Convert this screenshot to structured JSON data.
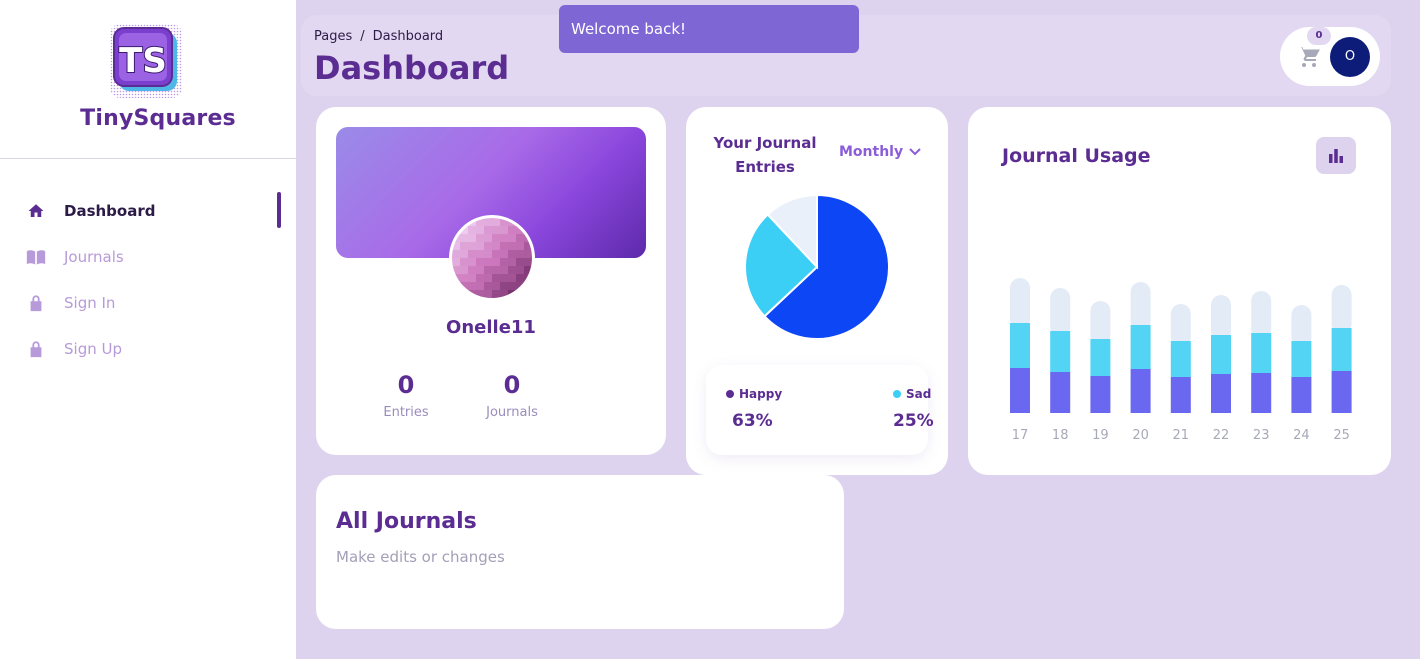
{
  "brand": {
    "name": "TinySquares",
    "logo_text": "TS"
  },
  "sidebar": {
    "items": [
      {
        "label": "Dashboard",
        "icon": "home-icon",
        "active": true
      },
      {
        "label": "Journals",
        "icon": "book-icon",
        "active": false
      },
      {
        "label": "Sign In",
        "icon": "lock-icon",
        "active": false
      },
      {
        "label": "Sign Up",
        "icon": "lock-icon",
        "active": false
      }
    ]
  },
  "header": {
    "breadcrumb": [
      "Pages",
      "Dashboard"
    ],
    "breadcrumb_sep": "/",
    "title": "Dashboard",
    "cart_count": "0",
    "avatar_initial": "O"
  },
  "toast": {
    "message": "Welcome back!"
  },
  "profile": {
    "username": "Onelle11",
    "entries_value": "0",
    "entries_label": "Entries",
    "journals_value": "0",
    "journals_label": "Journals"
  },
  "pie_card": {
    "title": "Your Journal Entries",
    "period": "Monthly"
  },
  "usage_card": {
    "title": "Journal Usage"
  },
  "journals_section": {
    "title": "All Journals",
    "subtitle": "Make edits or changes"
  },
  "colors": {
    "accent": "#5b2c91",
    "happy": "#0d47f5",
    "sad": "#3ccff5",
    "other": "#eaf0fa",
    "bar_base": "#6a67f0",
    "bar_mid": "#53d4f5",
    "bar_top": "#e3ebf6"
  },
  "chart_data": [
    {
      "type": "pie",
      "title": "Your Journal Entries",
      "slices": [
        {
          "name": "Happy",
          "value": 63,
          "color": "#0d47f5"
        },
        {
          "name": "Sad",
          "value": 25,
          "color": "#3ccff5"
        },
        {
          "name": "",
          "value": 12,
          "color": "#eaf0fa"
        }
      ],
      "legend": [
        {
          "name": "Happy",
          "value": "63%",
          "color": "#5b2c91"
        },
        {
          "name": "Sad",
          "value": "25%",
          "color": "#3ccff5"
        }
      ]
    },
    {
      "type": "bar",
      "title": "Journal Usage",
      "stacked": true,
      "categories": [
        "17",
        "18",
        "19",
        "20",
        "21",
        "22",
        "23",
        "24",
        "25"
      ],
      "series": [
        {
          "values": [
            45,
            41,
            37,
            44,
            36,
            39,
            40,
            36,
            42
          ],
          "color": "#6a67f0"
        },
        {
          "values": [
            45,
            41,
            37,
            44,
            36,
            39,
            40,
            36,
            43
          ],
          "color": "#53d4f5"
        },
        {
          "values": [
            45,
            43,
            38,
            43,
            37,
            40,
            42,
            36,
            43
          ],
          "color": "#e3ebf6"
        }
      ],
      "ylim": [
        0,
        135
      ]
    }
  ]
}
